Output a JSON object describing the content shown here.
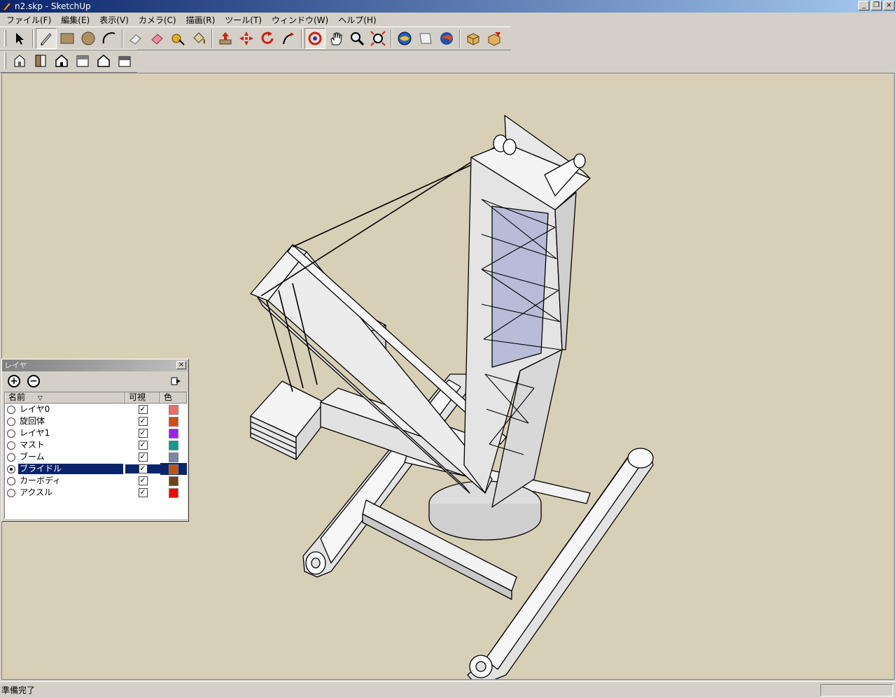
{
  "window": {
    "title": "n2.skp - SketchUp",
    "buttons": [
      "_",
      "❐",
      "×"
    ]
  },
  "menu": [
    "ファイル(F)",
    "編集(E)",
    "表示(V)",
    "カメラ(C)",
    "描画(R)",
    "ツール(T)",
    "ウィンドウ(W)",
    "ヘルプ(H)"
  ],
  "toolbar_main": [
    "select-tool",
    "pencil-tool",
    "rectangle-tool",
    "circle-tool",
    "arc-tool",
    "eraser-tool",
    "paint-bucket-tool",
    "tape-measure-tool",
    "move-tool",
    "push-pull-tool",
    "move-arrows-tool",
    "rotate-tool",
    "offset-tool",
    "orbit-tool",
    "pan-tool",
    "zoom-tool",
    "zoom-extents-tool",
    "previous-view-tool",
    "section-tool",
    "walk-tool",
    "component-tool",
    "group-tool"
  ],
  "toolbar_views": [
    "iso-view",
    "top-view",
    "front-view",
    "right-view",
    "back-view",
    "left-view"
  ],
  "status": {
    "text": "準備完了"
  },
  "layer_panel": {
    "title": "レイヤ",
    "add_label": "+",
    "remove_label": "−",
    "columns": {
      "name": "名前",
      "visible": "可視",
      "color": "色"
    },
    "sort_indicator": "▽",
    "layers": [
      {
        "name": "レイヤ0",
        "visible": "✓",
        "color": "#f26b6b",
        "active": false
      },
      {
        "name": "旋回体",
        "visible": "✓",
        "color": "#d44d14",
        "active": false
      },
      {
        "name": "レイヤ1",
        "visible": "✓",
        "color": "#a020f0",
        "active": false
      },
      {
        "name": "マスト",
        "visible": "✓",
        "color": "#129c8c",
        "active": false
      },
      {
        "name": "ブーム",
        "visible": "✓",
        "color": "#7b86a6",
        "active": false
      },
      {
        "name": "ブライドル",
        "visible": "✓",
        "color": "#c0520e",
        "active": true
      },
      {
        "name": "カーボディ",
        "visible": "✓",
        "color": "#6b4513",
        "active": false
      },
      {
        "name": "アクスル",
        "visible": "✓",
        "color": "#ff0000",
        "active": false
      }
    ]
  }
}
